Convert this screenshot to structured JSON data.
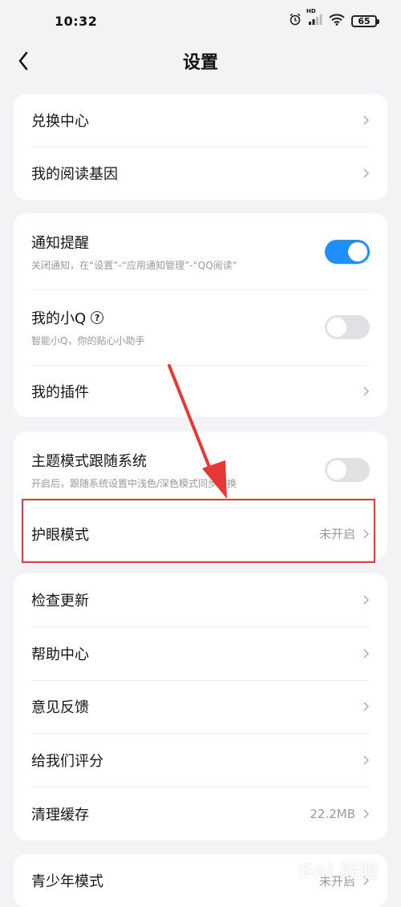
{
  "status_bar": {
    "time": "10:32",
    "battery": "65",
    "hd_label": "HD"
  },
  "header": {
    "title": "设置"
  },
  "sections": {
    "s1": {
      "exchange": {
        "label": "兑换中心"
      },
      "reading_gene": {
        "label": "我的阅读基因"
      }
    },
    "s2": {
      "notify": {
        "label": "通知提醒",
        "sub": "关闭通知，在“设置”-“应用通知管理”-“QQ阅读”",
        "toggle": "on"
      },
      "little_q": {
        "label": "我的小Q",
        "sub": "智能小Q，你的贴心小助手",
        "toggle": "off"
      },
      "plugins": {
        "label": "我的插件"
      }
    },
    "s3": {
      "theme": {
        "label": "主题模式跟随系统",
        "sub": "开启后，跟随系统设置中浅色/深色模式同步切换",
        "toggle": "off"
      },
      "eye": {
        "label": "护眼模式",
        "value": "未开启"
      }
    },
    "s4": {
      "update": {
        "label": "检查更新"
      },
      "help": {
        "label": "帮助中心"
      },
      "feedback": {
        "label": "意见反馈"
      },
      "rate": {
        "label": "给我们评分"
      },
      "cache": {
        "label": "清理缓存",
        "value": "22.2MB"
      }
    },
    "s5": {
      "youth": {
        "label": "青少年模式",
        "value": "未开启"
      }
    }
  },
  "watermark": "Bai 经验",
  "colors": {
    "accent": "#1f8fff",
    "highlight": "#e53935",
    "background": "#f3f3f5"
  }
}
